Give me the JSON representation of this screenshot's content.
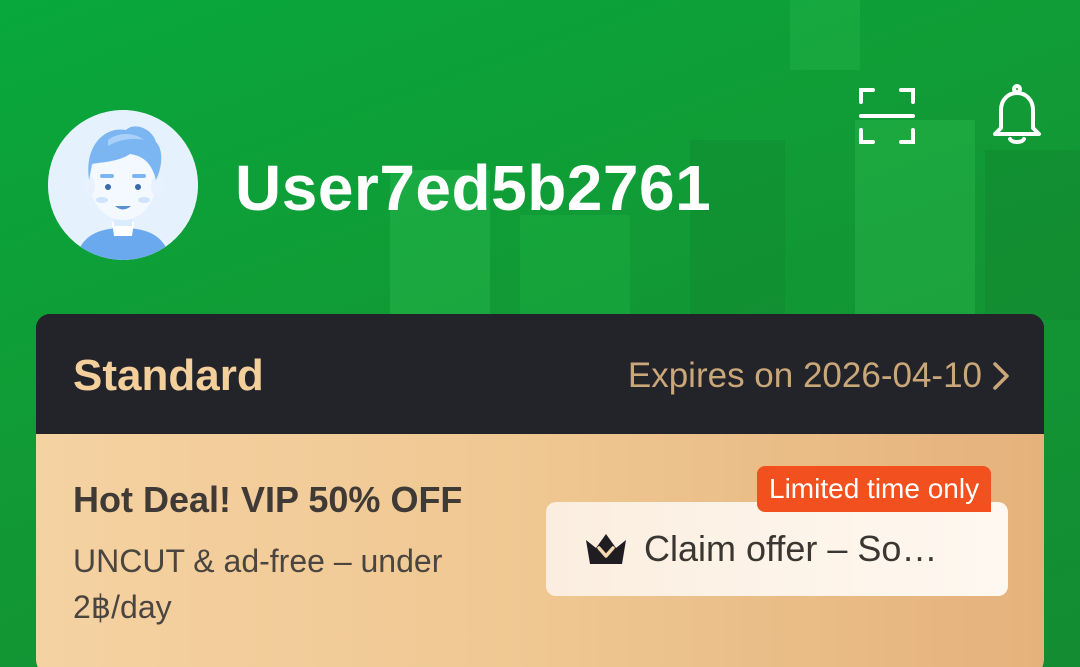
{
  "profile": {
    "username": "User7ed5b2761",
    "avatar_icon": "user-avatar-icon"
  },
  "header": {
    "scan_icon": "scan-icon",
    "bell_icon": "bell-icon"
  },
  "membership": {
    "plan_name": "Standard",
    "expires_text": "Expires on 2026-04-10",
    "chevron_icon": "chevron-right-icon"
  },
  "promo": {
    "title": "Hot Deal! VIP 50% OFF",
    "subtitle": "UNCUT & ad-free – under 2฿/day",
    "badge": "Limited time only",
    "button_label": "Claim offer – So…",
    "button_icon": "crown-icon"
  },
  "colors": {
    "banner_green": "#0fa03a",
    "card_dark": "#23232a",
    "gold_text": "#f3cf9b",
    "promo_gold": "#efc791",
    "badge_orange": "#f2501f"
  }
}
